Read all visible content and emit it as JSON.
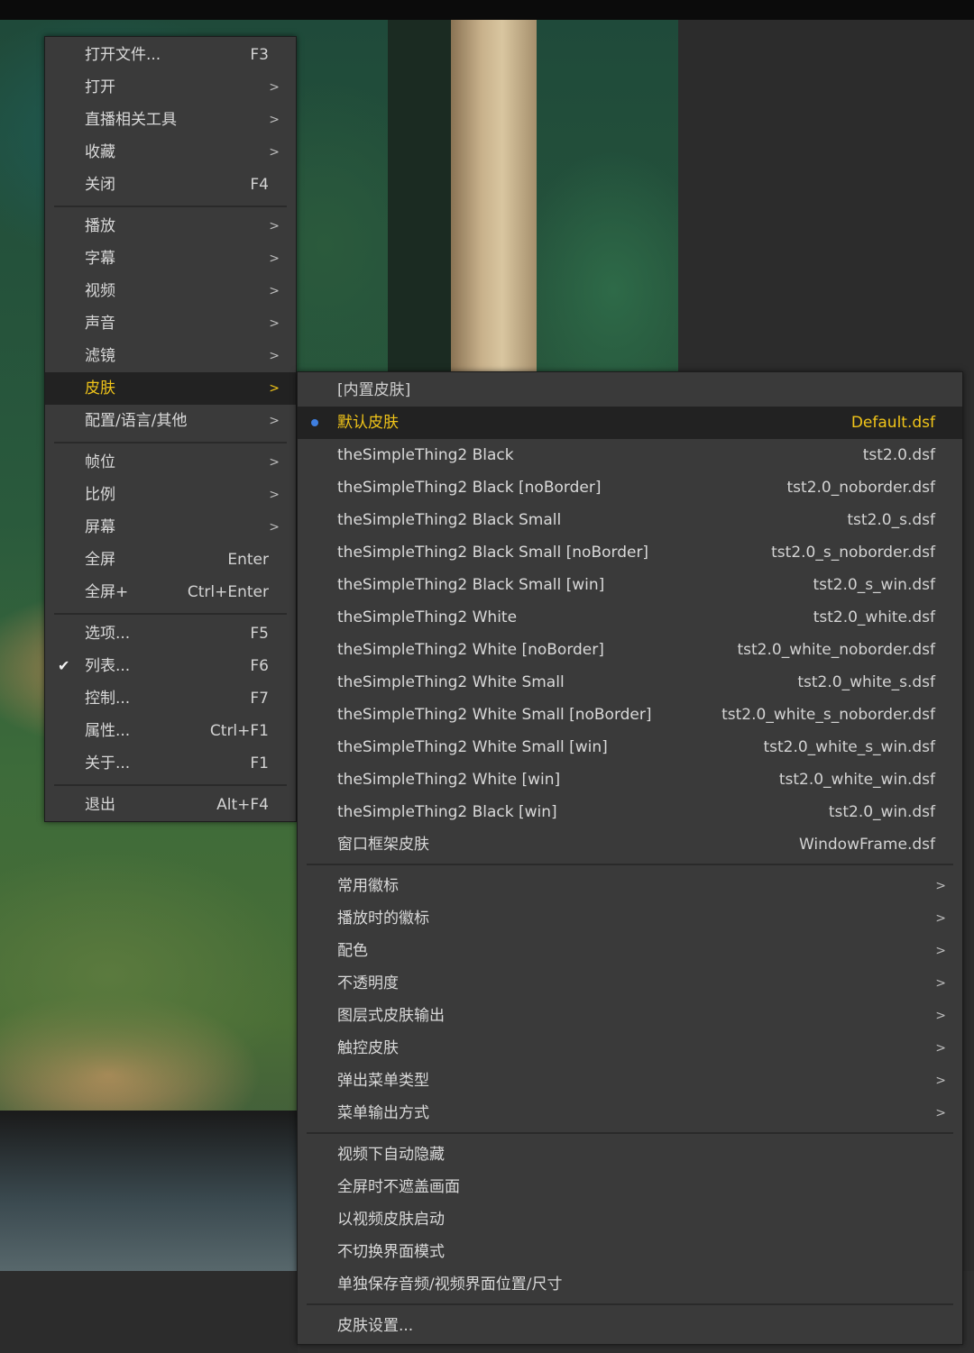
{
  "colors": {
    "menu_bg": "#3a3a3a",
    "highlight_bg": "#222222",
    "highlight_text": "#f0c419",
    "radio_dot": "#3f7fe0"
  },
  "main_menu": {
    "items": [
      {
        "label": "打开文件...",
        "shortcut": "F3",
        "icon": ""
      },
      {
        "label": "打开",
        "arrow": ">"
      },
      {
        "label": "直播相关工具",
        "arrow": ">"
      },
      {
        "label": "收藏",
        "arrow": ">"
      },
      {
        "label": "关闭",
        "shortcut": "F4"
      },
      {
        "label": "播放",
        "arrow": ">"
      },
      {
        "label": "字幕",
        "arrow": ">"
      },
      {
        "label": "视频",
        "arrow": ">"
      },
      {
        "label": "声音",
        "arrow": ">"
      },
      {
        "label": "滤镜",
        "arrow": ">"
      },
      {
        "label": "皮肤",
        "arrow": ">",
        "highlighted": true
      },
      {
        "label": "配置/语言/其他",
        "arrow": ">"
      },
      {
        "label": "帧位",
        "arrow": ">"
      },
      {
        "label": "比例",
        "arrow": ">"
      },
      {
        "label": "屏幕",
        "arrow": ">"
      },
      {
        "label": "全屏",
        "shortcut": "Enter"
      },
      {
        "label": "全屏+",
        "shortcut": "Ctrl+Enter"
      },
      {
        "label": "选项...",
        "shortcut": "F5"
      },
      {
        "label": "列表...",
        "shortcut": "F6",
        "checked": true
      },
      {
        "label": "控制...",
        "shortcut": "F7"
      },
      {
        "label": "属性...",
        "shortcut": "Ctrl+F1"
      },
      {
        "label": "关于...",
        "shortcut": "F1"
      },
      {
        "label": "退出",
        "shortcut": "Alt+F4"
      }
    ]
  },
  "skin_menu": {
    "header": "[内置皮肤]",
    "skins": [
      {
        "label": "默认皮肤",
        "file": "Default.dsf",
        "selected": true
      },
      {
        "label": "theSimpleThing2 Black",
        "file": "tst2.0.dsf"
      },
      {
        "label": "theSimpleThing2 Black [noBorder]",
        "file": "tst2.0_noborder.dsf"
      },
      {
        "label": "theSimpleThing2 Black Small",
        "file": "tst2.0_s.dsf"
      },
      {
        "label": "theSimpleThing2 Black Small [noBorder]",
        "file": "tst2.0_s_noborder.dsf"
      },
      {
        "label": "theSimpleThing2 Black Small [win]",
        "file": "tst2.0_s_win.dsf"
      },
      {
        "label": "theSimpleThing2 White",
        "file": "tst2.0_white.dsf"
      },
      {
        "label": "theSimpleThing2 White [noBorder]",
        "file": "tst2.0_white_noborder.dsf"
      },
      {
        "label": "theSimpleThing2 White Small",
        "file": "tst2.0_white_s.dsf"
      },
      {
        "label": "theSimpleThing2 White Small [noBorder]",
        "file": "tst2.0_white_s_noborder.dsf"
      },
      {
        "label": "theSimpleThing2 White Small [win]",
        "file": "tst2.0_white_s_win.dsf"
      },
      {
        "label": "theSimpleThing2 White [win]",
        "file": "tst2.0_white_win.dsf"
      },
      {
        "label": "theSimpleThing2 Black [win]",
        "file": "tst2.0_win.dsf"
      },
      {
        "label": "窗口框架皮肤",
        "file": "WindowFrame.dsf"
      }
    ],
    "submenus": [
      {
        "label": "常用徽标",
        "arrow": ">"
      },
      {
        "label": "播放时的徽标",
        "arrow": ">"
      },
      {
        "label": "配色",
        "arrow": ">"
      },
      {
        "label": "不透明度",
        "arrow": ">"
      },
      {
        "label": "图层式皮肤输出",
        "arrow": ">"
      },
      {
        "label": "触控皮肤",
        "arrow": ">"
      },
      {
        "label": "弹出菜单类型",
        "arrow": ">"
      },
      {
        "label": "菜单输出方式",
        "arrow": ">"
      }
    ],
    "options": [
      {
        "label": "视频下自动隐藏"
      },
      {
        "label": "全屏时不遮盖画面"
      },
      {
        "label": "以视频皮肤启动"
      },
      {
        "label": "不切换界面模式"
      },
      {
        "label": "单独保存音频/视频界面位置/尺寸"
      }
    ],
    "footer": {
      "label": "皮肤设置..."
    }
  }
}
